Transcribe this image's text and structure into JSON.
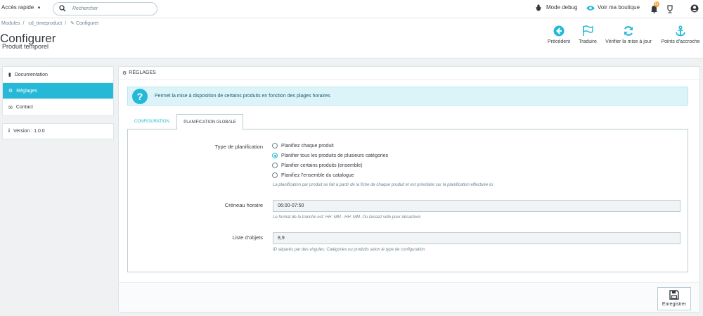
{
  "topbar": {
    "quick_access": "Accès rapide",
    "search_placeholder": "Rechercher",
    "debug": "Mode debug",
    "view_shop": "Voir ma boutique",
    "notif_count": "11"
  },
  "header": {
    "breadcrumb": [
      "Modules",
      "cd_timeproduct",
      "Configurer"
    ],
    "title": "Configurer",
    "subtitle": "Produit temporel",
    "actions": [
      {
        "label": "Précédent",
        "icon": "back-circle-icon"
      },
      {
        "label": "Traduire",
        "icon": "flag-icon"
      },
      {
        "label": "Vérifier la mise à jour",
        "icon": "refresh-icon"
      },
      {
        "label": "Points d'accroche",
        "icon": "anchor-icon"
      }
    ]
  },
  "sidebar": {
    "items": [
      {
        "label": "Documentation",
        "icon": "book-icon"
      },
      {
        "label": "Réglages",
        "icon": "cogs-icon",
        "active": true
      },
      {
        "label": "Contact",
        "icon": "envelope-icon"
      }
    ],
    "version": "Version : 1.0.0"
  },
  "panel": {
    "title": "RÉGLAGES",
    "alert": "Permet la mise à disposition de certains produits en fonction des plages horaires",
    "tabs": [
      "CONFIGURATION",
      "PLANIFICATION GLOBALE"
    ],
    "form": {
      "type_label": "Type de planification",
      "options": [
        "Planifiez chaque produit",
        "Planifier tous les produits de plusieurs catégories",
        "Planifier certains produits (ensemble)",
        "Planifiez l'ensemble du catalogue"
      ],
      "selected_index": 1,
      "type_help": "La planification par produit se fait à partir de la fiche de chaque produit et est prioritaire sur la planification effectuée ici",
      "slot_label": "Créneau horaire",
      "slot_value": "06:00-07:50",
      "slot_help": "Le format de la tranche est: HH: MM - HH: MM. Ou laissez vide pour désactiver",
      "list_label": "Liste d'objets",
      "list_value": "8,9",
      "list_help": "ID séparés par des virgules: Catégories ou produits selon le type de configuration"
    },
    "save_label": "Enregistrer"
  },
  "colors": {
    "accent": "#25b9d7",
    "background": "#eff1f2",
    "alert_bg": "#dcf4f9"
  }
}
